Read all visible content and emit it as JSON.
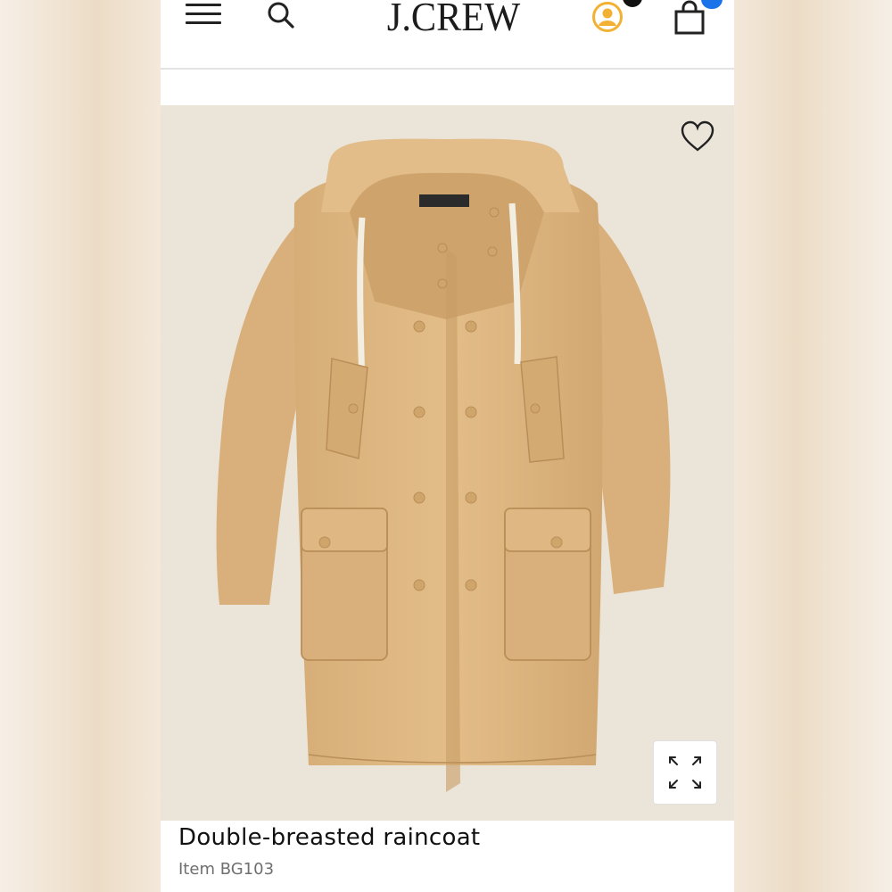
{
  "header": {
    "brand_logo": "J.CREW",
    "icons": [
      "menu-icon",
      "search-icon",
      "account-icon",
      "shopping-bag-icon"
    ]
  },
  "product": {
    "title": "Double-breasted raincoat",
    "item_number": "Item BG103",
    "image_icons": [
      "heart-icon",
      "expand-icon"
    ]
  },
  "colors": {
    "accent_blue": "#1a73e8",
    "account_icon": "#f2b132",
    "coat": "#dfb782",
    "image_background": "#ebe4d8"
  }
}
